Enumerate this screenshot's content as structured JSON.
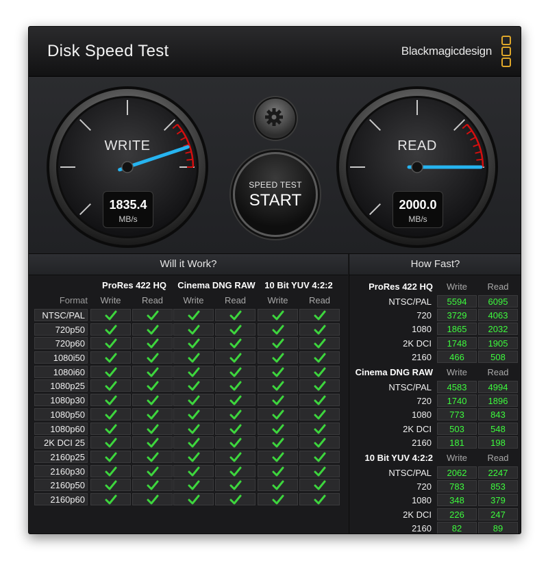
{
  "window": {
    "title": "Disk Speed Test",
    "brand": "Blackmagicdesign",
    "close_icon": "×"
  },
  "colors": {
    "needle": "#26b4f0",
    "redline": "#d40f0f",
    "check": "#3dd63d",
    "value_text": "#3dfc3d",
    "brand_logo": "#e0a82a"
  },
  "gauges": {
    "write": {
      "label": "WRITE",
      "value": "1835.4",
      "unit": "MB/s",
      "needle_fraction": 0.918
    },
    "read": {
      "label": "READ",
      "value": "2000.0",
      "unit": "MB/s",
      "needle_fraction": 1.0
    }
  },
  "controls": {
    "settings_icon": "gear-icon",
    "start_top": "SPEED TEST",
    "start_main": "START"
  },
  "will_it_work": {
    "header": "Will it Work?",
    "format_label": "Format",
    "groups": [
      "ProRes 422 HQ",
      "Cinema DNG RAW",
      "10 Bit YUV 4:2:2"
    ],
    "subheaders": [
      "Write",
      "Read"
    ],
    "formats": [
      "NTSC/PAL",
      "720p50",
      "720p60",
      "1080i50",
      "1080i60",
      "1080p25",
      "1080p30",
      "1080p50",
      "1080p60",
      "2K DCI 25",
      "2160p25",
      "2160p30",
      "2160p50",
      "2160p60"
    ],
    "all_supported": true
  },
  "how_fast": {
    "header": "How Fast?",
    "write_label": "Write",
    "read_label": "Read",
    "groups": [
      {
        "name": "ProRes 422 HQ",
        "rows": [
          {
            "format": "NTSC/PAL",
            "write": "5594",
            "read": "6095"
          },
          {
            "format": "720",
            "write": "3729",
            "read": "4063"
          },
          {
            "format": "1080",
            "write": "1865",
            "read": "2032"
          },
          {
            "format": "2K DCI",
            "write": "1748",
            "read": "1905"
          },
          {
            "format": "2160",
            "write": "466",
            "read": "508"
          }
        ]
      },
      {
        "name": "Cinema DNG RAW",
        "rows": [
          {
            "format": "NTSC/PAL",
            "write": "4583",
            "read": "4994"
          },
          {
            "format": "720",
            "write": "1740",
            "read": "1896"
          },
          {
            "format": "1080",
            "write": "773",
            "read": "843"
          },
          {
            "format": "2K DCI",
            "write": "503",
            "read": "548"
          },
          {
            "format": "2160",
            "write": "181",
            "read": "198"
          }
        ]
      },
      {
        "name": "10 Bit YUV 4:2:2",
        "rows": [
          {
            "format": "NTSC/PAL",
            "write": "2062",
            "read": "2247"
          },
          {
            "format": "720",
            "write": "783",
            "read": "853"
          },
          {
            "format": "1080",
            "write": "348",
            "read": "379"
          },
          {
            "format": "2K DCI",
            "write": "226",
            "read": "247"
          },
          {
            "format": "2160",
            "write": "82",
            "read": "89"
          }
        ]
      }
    ]
  }
}
